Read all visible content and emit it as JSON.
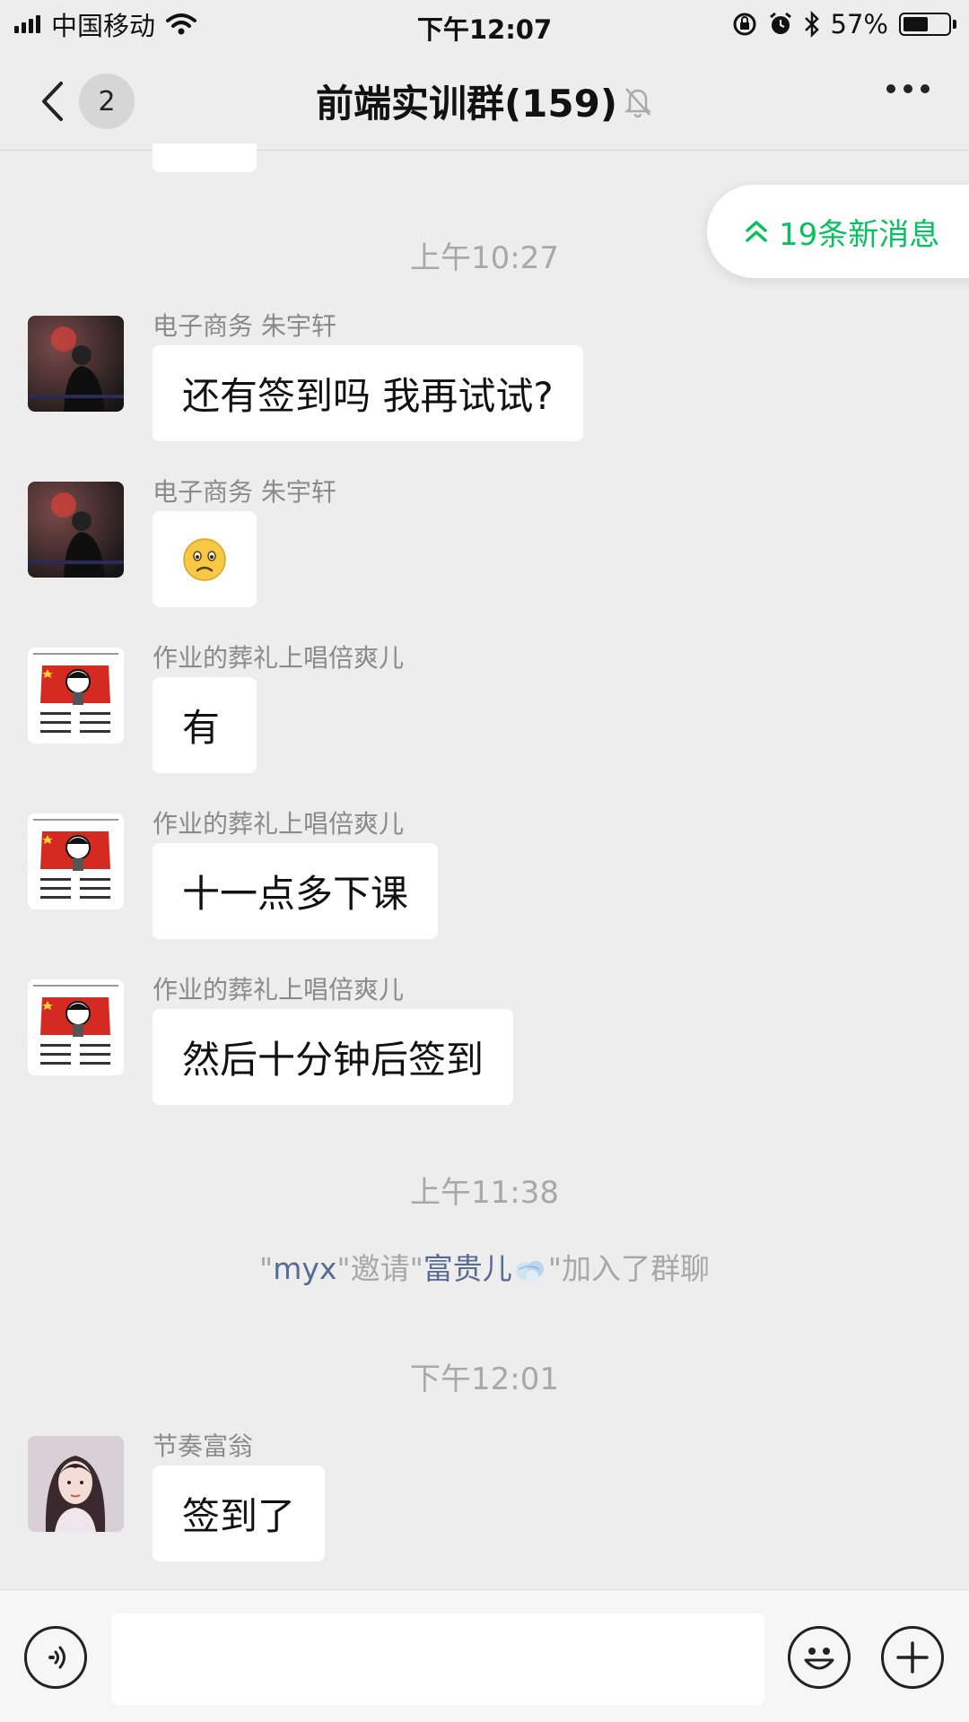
{
  "status_bar": {
    "carrier": "中国移动",
    "time": "下午12:07",
    "battery": "57%",
    "battery_level": 0.57
  },
  "nav": {
    "back_count": "2",
    "title": "前端实训群(159)"
  },
  "new_messages": {
    "label": "19条新消息"
  },
  "timestamps": [
    "上午10:27",
    "上午11:38",
    "下午12:01"
  ],
  "messages": [
    {
      "sender": "电子商务 朱宇轩",
      "text": "还有签到吗 我再试试?"
    },
    {
      "sender": "电子商务 朱宇轩",
      "text": "",
      "emoji": "sad-face"
    },
    {
      "sender": "作业的葬礼上唱倍爽儿",
      "text": "有"
    },
    {
      "sender": "作业的葬礼上唱倍爽儿",
      "text": "十一点多下课"
    },
    {
      "sender": "作业的葬礼上唱倍爽儿",
      "text": "然后十分钟后签到"
    },
    {
      "sender": "节奏富翁",
      "text": "签到了"
    }
  ],
  "system_message": {
    "q1": "\"",
    "inviter": "myx",
    "mid": "\"邀请\"",
    "invitee": "富贵儿",
    "end": "\"加入了群聊"
  },
  "input_bar": {
    "placeholder": ""
  },
  "colors": {
    "accent": "#07c160",
    "link": "#576b95",
    "background": "#ededed"
  }
}
